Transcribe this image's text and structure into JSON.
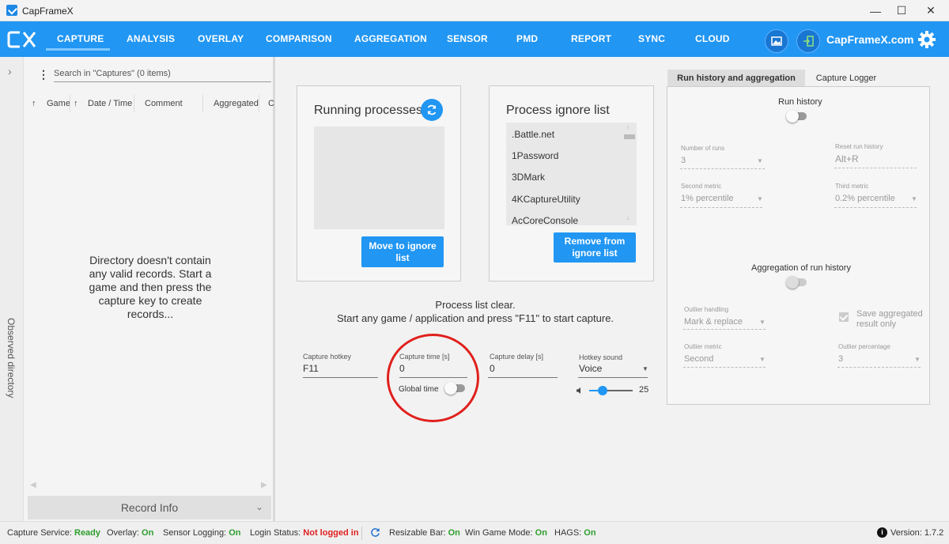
{
  "window": {
    "title": "CapFrameX",
    "minimize": "—",
    "maximize": "☐",
    "close": "✕"
  },
  "nav": {
    "items": [
      "CAPTURE",
      "ANALYSIS",
      "OVERLAY",
      "COMPARISON",
      "AGGREGATION",
      "SENSOR",
      "PMD",
      "REPORT",
      "SYNC",
      "CLOUD"
    ],
    "active": "CAPTURE",
    "site_link": "CapFrameX.com",
    "accent": "#2196f3"
  },
  "sidebar": {
    "vertical_label": "Observed directory"
  },
  "left_panel": {
    "search_placeholder": "Search in \"Captures\" (0 items)",
    "columns": [
      "Game",
      "Date / Time",
      "Comment",
      "Aggregated",
      "C"
    ],
    "empty_message": "Directory doesn't contain any valid records. Start a game and then press the capture key to create records...",
    "record_info": "Record Info"
  },
  "running": {
    "title": "Running processes",
    "move_button": "Move to ignore list"
  },
  "ignore": {
    "title": "Process ignore list",
    "items": [
      ".Battle.net",
      "1Password",
      "3DMark",
      "4KCaptureUtility",
      "AcCoreConsole"
    ],
    "remove_button": "Remove from ignore list"
  },
  "status": {
    "line1": "Process list clear.",
    "line2": "Start any game / application and press \"F11\" to start capture."
  },
  "fields": {
    "hotkey_label": "Capture hotkey",
    "hotkey_value": "F11",
    "time_label": "Capture time [s]",
    "time_value": "0",
    "global_time_label": "Global time",
    "delay_label": "Capture delay [s]",
    "delay_value": "0",
    "sound_label": "Hotkey sound",
    "sound_value": "Voice",
    "volume_value": "25",
    "volume_fraction": 0.25
  },
  "right_panel": {
    "tabs": [
      "Run history and aggregation",
      "Capture Logger"
    ],
    "run_history_title": "Run history",
    "number_of_runs_label": "Number of runs",
    "number_of_runs_value": "3",
    "reset_label": "Reset run history",
    "reset_value": "Alt+R",
    "second_metric_label": "Second metric",
    "second_metric_value": "1% percentile",
    "third_metric_label": "Third metric",
    "third_metric_value": "0.2% percentile",
    "aggregation_title": "Aggregation of run history",
    "outlier_handling_label": "Outlier handling",
    "outlier_handling_value": "Mark & replace",
    "save_aggregated_label": "Save aggregated result only",
    "outlier_metric_label": "Outlier metric",
    "outlier_metric_value": "Second",
    "outlier_percentage_label": "Outlier percentage",
    "outlier_percentage_value": "3"
  },
  "statusbar": {
    "capture_service_label": "Capture Service:",
    "capture_service_value": "Ready",
    "overlay_label": "Overlay:",
    "overlay_value": "On",
    "sensor_logging_label": "Sensor Logging:",
    "sensor_logging_value": "On",
    "login_status_label": "Login Status:",
    "login_status_value": "Not logged in",
    "resizable_bar_label": "Resizable Bar:",
    "resizable_bar_value": "On",
    "win_game_mode_label": "Win Game Mode:",
    "win_game_mode_value": "On",
    "hags_label": "HAGS:",
    "hags_value": "On",
    "version_label": "Version:",
    "version_value": "1.7.2"
  }
}
